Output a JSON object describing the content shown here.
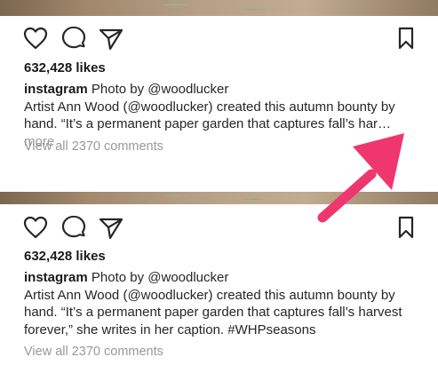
{
  "posts": [
    {
      "likes": "632,428 likes",
      "username": "instagram",
      "caption_lead": "Photo by ",
      "mention": "@woodlucker",
      "line1": "Artist Ann Wood (@woodlucker) created this autumn bounty by",
      "line2": "hand. “It’s a permanent paper garden that captures fall’s har…",
      "more_label": " more",
      "view_comments": "View all 2370 comments"
    },
    {
      "likes": "632,428 likes",
      "username": "instagram",
      "caption_lead": "Photo by ",
      "mention": "@woodlucker",
      "line1": "Artist Ann Wood (@woodlucker) created this autumn bounty by",
      "line2": "hand. “It’s a permanent paper garden that captures fall’s harvest",
      "line3": "forever,” she writes in her caption. #WHPseasons",
      "view_comments": "View all 2370 comments"
    }
  ],
  "icons": {
    "like": "heart-icon",
    "comment": "comment-icon",
    "share": "send-icon",
    "save": "bookmark-icon"
  },
  "colors": {
    "annotation_arrow": "#f0366f",
    "text": "#262626",
    "muted": "#999999"
  }
}
